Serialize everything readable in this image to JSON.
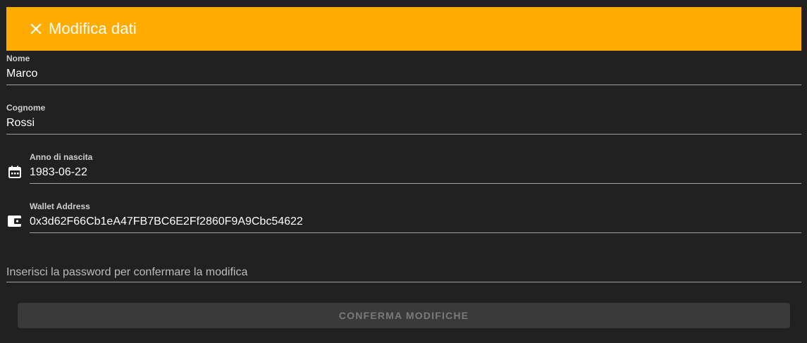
{
  "header": {
    "title": "Modifica dati",
    "background_color": "#ffab00",
    "close_icon": "close-icon"
  },
  "form": {
    "nome": {
      "label": "Nome",
      "value": "Marco"
    },
    "cognome": {
      "label": "Cognome",
      "value": "Rossi"
    },
    "anno_nascita": {
      "label": "Anno di nascita",
      "value": "1983-06-22",
      "icon": "calendar-icon"
    },
    "wallet": {
      "label": "Wallet Address",
      "value": "0x3d62F66Cb1eA47FB7BC6E2Ff2860F9A9Cbc54622",
      "icon": "wallet-icon"
    },
    "password": {
      "placeholder": "Inserisci la password per confermare la modifica",
      "value": ""
    }
  },
  "actions": {
    "confirm_label": "CONFERMA MODIFICHE",
    "confirm_disabled": true
  },
  "colors": {
    "background": "#212121",
    "accent": "#ffab00",
    "button_disabled_bg": "#3a3a3a",
    "button_disabled_text": "#7a7a7a"
  }
}
